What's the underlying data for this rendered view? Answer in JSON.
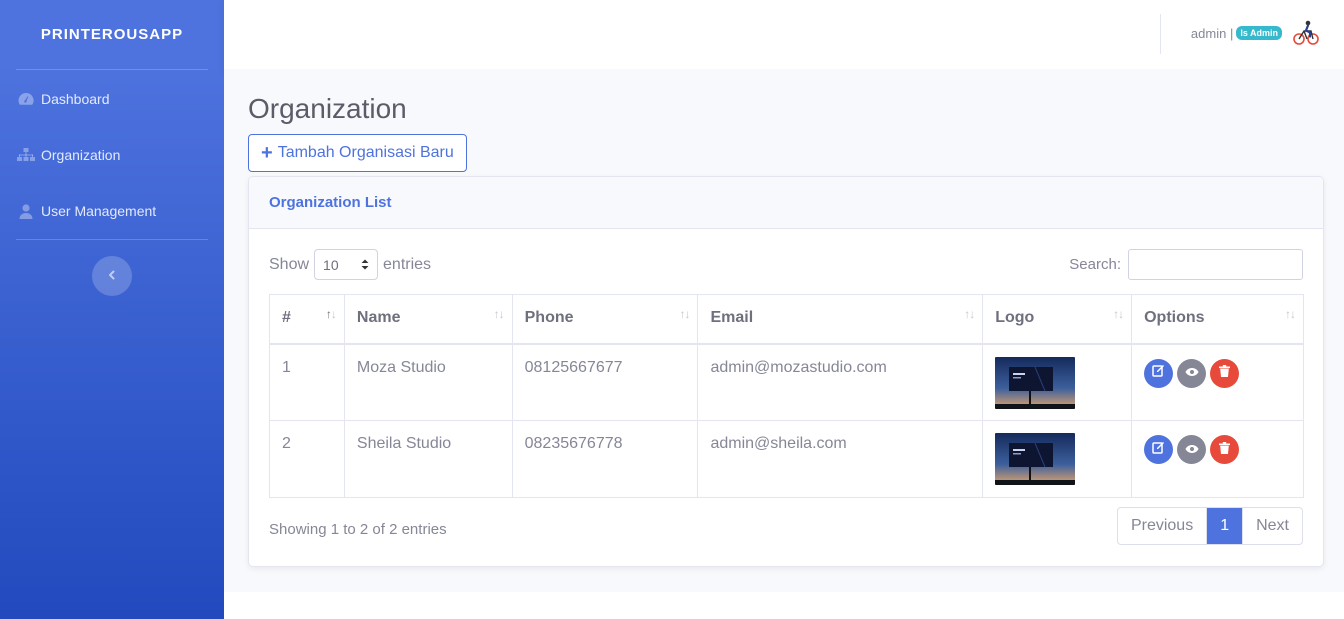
{
  "sidebar": {
    "brand": "PRINTEROUSAPP",
    "items": [
      {
        "label": "Dashboard",
        "icon": "dashboard-gauge-icon"
      },
      {
        "label": "Organization",
        "icon": "sitemap-icon"
      },
      {
        "label": "User Management",
        "icon": "user-icon"
      }
    ],
    "toggle_icon": "chevron-left-icon"
  },
  "topbar": {
    "user_name": "admin |",
    "role_badge": "Is Admin",
    "avatar_icon": "cyclist-avatar-icon"
  },
  "page": {
    "title": "Organization",
    "add_button": "Tambah Organisasi Baru"
  },
  "card": {
    "title": "Organization List",
    "show_label": "Show",
    "entries_value": "10",
    "entries_label": "entries",
    "search_label": "Search:",
    "search_value": "",
    "columns": [
      "#",
      "Name",
      "Phone",
      "Email",
      "Logo",
      "Options"
    ],
    "rows": [
      {
        "no": "1",
        "name": "Moza Studio",
        "phone": "08125667677",
        "email": "admin@mozastudio.com",
        "logo": "billboard-image"
      },
      {
        "no": "2",
        "name": "Sheila Studio",
        "phone": "08235676778",
        "email": "admin@sheila.com",
        "logo": "billboard-image"
      }
    ],
    "info": "Showing 1 to 2 of 2 entries",
    "pagination": {
      "previous": "Previous",
      "current": "1",
      "next": "Next"
    }
  },
  "colors": {
    "primary": "#4e73df",
    "info_badge": "#36b9cc",
    "danger": "#e74a3b",
    "secondary": "#858796"
  }
}
